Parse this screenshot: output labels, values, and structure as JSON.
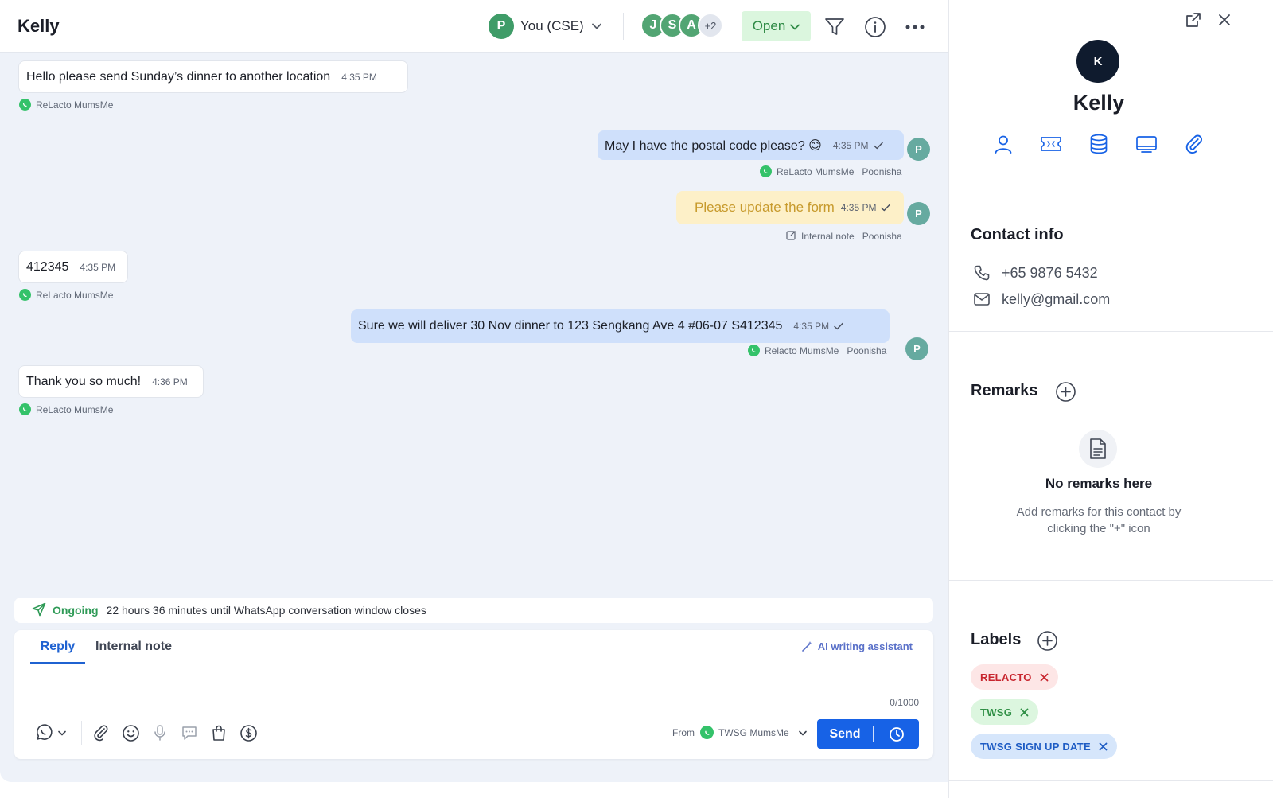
{
  "header": {
    "contact_name": "Kelly",
    "assignee": {
      "initial": "P",
      "label": "You (CSE)"
    },
    "participants": [
      "J",
      "S",
      "A"
    ],
    "participants_more": "+2",
    "status": "Open"
  },
  "messages": [
    {
      "text": "Hello please send Sunday’s dinner to another location",
      "time": "4:35 PM",
      "source": "ReLacto MumsMe"
    },
    {
      "text": "May I have the postal code please? 😊",
      "time": "4:35 PM",
      "source": "ReLacto MumsMe",
      "agent": "Poonisha",
      "avatar": "P"
    },
    {
      "text": "Please update the form",
      "time": "4:35 PM",
      "source": "Internal note",
      "agent": "Poonisha",
      "avatar": "P"
    },
    {
      "text": "412345",
      "time": "4:35 PM",
      "source": "ReLacto MumsMe"
    },
    {
      "text": "Sure we will deliver 30 Nov dinner to 123 Sengkang Ave 4 #06-07 S412345",
      "time": "4:35 PM",
      "source": "Relacto MumsMe",
      "agent": "Poonisha",
      "avatar": "P"
    },
    {
      "text": "Thank you so much!",
      "time": "4:36 PM",
      "source": "ReLacto MumsMe"
    }
  ],
  "ongoing": {
    "label": "Ongoing",
    "text": "22 hours 36 minutes until WhatsApp conversation window closes"
  },
  "composer": {
    "tab_reply": "Reply",
    "tab_internal": "Internal note",
    "ai_assistant": "AI writing assistant",
    "counter": "0/1000",
    "from_label": "From",
    "from_value": "TWSG MumsMe",
    "send_label": "Send"
  },
  "contact": {
    "initial": "K",
    "name": "Kelly",
    "info_title": "Contact info",
    "phone": "+65 9876 5432",
    "email": "kelly@gmail.com"
  },
  "remarks": {
    "title": "Remarks",
    "empty_title": "No remarks here",
    "empty_desc": "Add remarks for this contact by clicking the \"+\" icon"
  },
  "labels": {
    "title": "Labels",
    "items": [
      {
        "text": "RELACTO",
        "bg": "#fde6e6",
        "fg": "#c8262f"
      },
      {
        "text": "TWSG",
        "bg": "#dcf6df",
        "fg": "#2f8f45"
      },
      {
        "text": "TWSG SIGN UP DATE",
        "bg": "#d6e6fb",
        "fg": "#1e5cc4"
      }
    ]
  },
  "colors": {
    "brand_blue": "#1762e6",
    "whatsapp_green": "#34c26a",
    "open_status": "#2e8a45"
  }
}
